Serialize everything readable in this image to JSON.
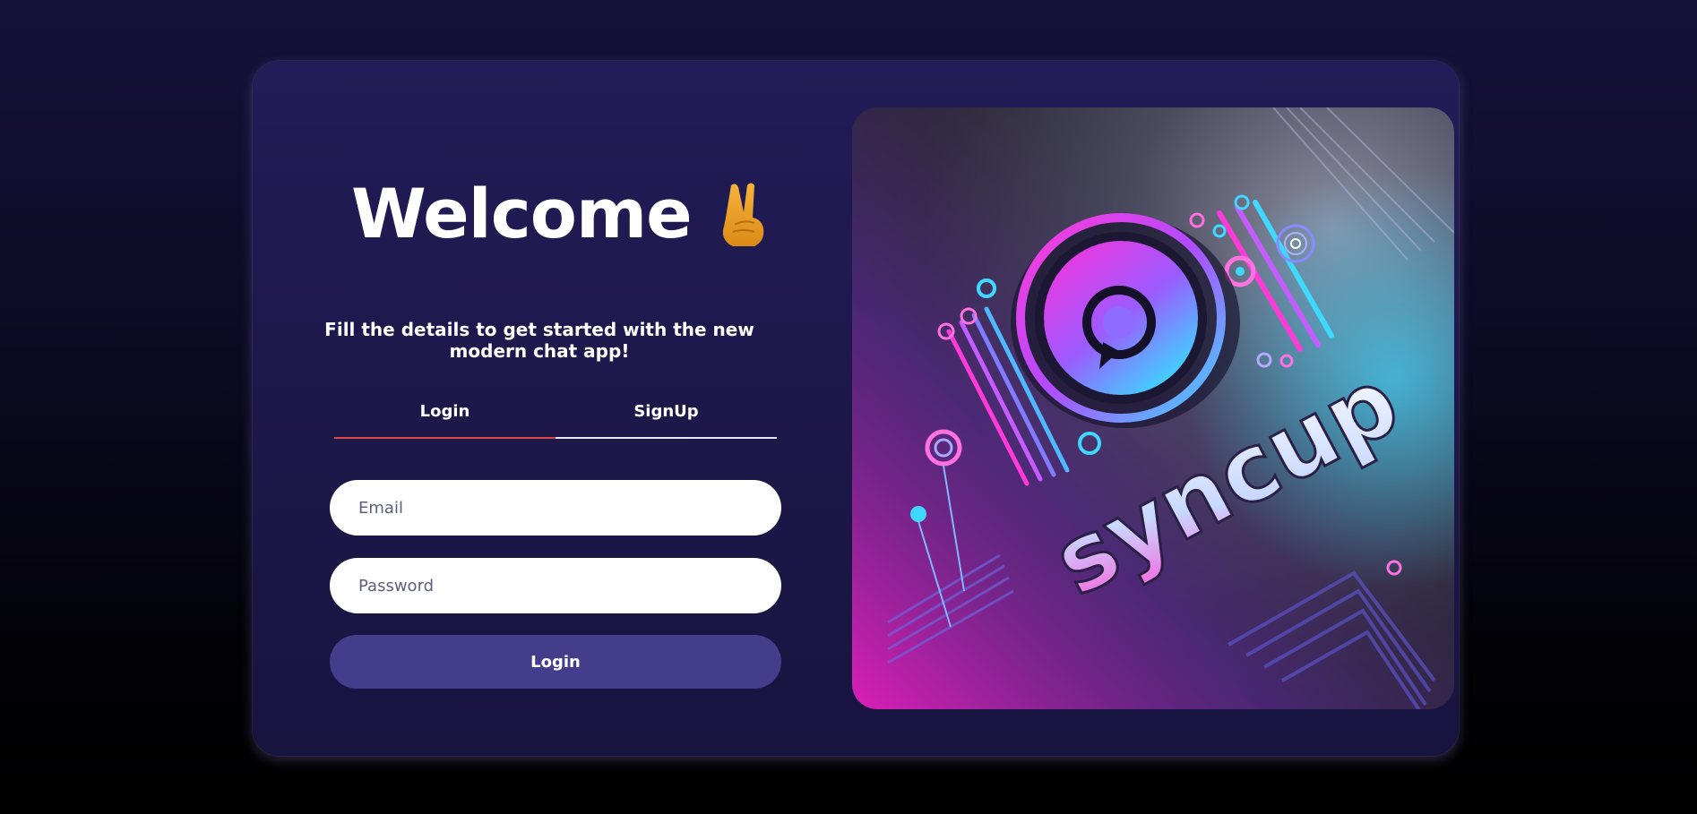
{
  "welcome": {
    "title": "Welcome",
    "hand_icon": "victory-hand-icon",
    "subtitle": "Fill the details to get started with the new modern chat app!"
  },
  "tabs": [
    {
      "label": "Login",
      "active": true
    },
    {
      "label": "SignUp",
      "active": false
    }
  ],
  "form": {
    "email_placeholder": "Email",
    "email_value": "",
    "password_placeholder": "Password",
    "password_value": "",
    "submit_label": "Login"
  },
  "hero": {
    "brand_text": "syncup",
    "logo_icon": "chat-bubble-icon"
  },
  "colors": {
    "background": "#0c0a22",
    "card": "#1e1a4c",
    "active_tab_underline": "#d94848",
    "button": "#443d8c",
    "accent_magenta": "#ff2bd6",
    "accent_cyan": "#3fd8ff"
  }
}
